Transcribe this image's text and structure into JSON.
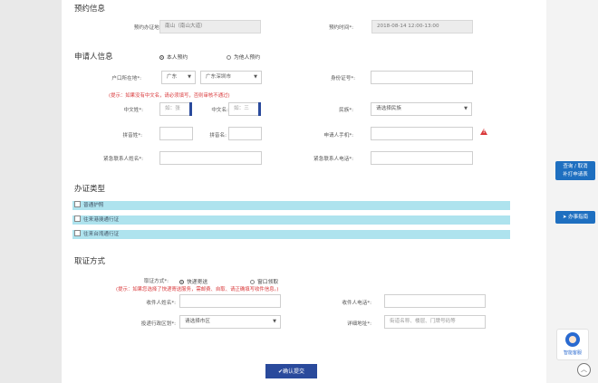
{
  "sections": {
    "booking": "预约信息",
    "applicant": "申请人信息",
    "type": "办证类型",
    "pickup": "取证方式"
  },
  "booking": {
    "location_label": "预约办证地点*:",
    "location_value": "南山（南山大道）",
    "time_label": "预约时间*:",
    "time_value": "2018-08-14 12:00-13:00"
  },
  "applicant": {
    "self_label": "本人预约",
    "other_label": "为他人预约",
    "hukou_label": "户口所在地*:",
    "province": "广东",
    "city": "广东深圳市",
    "id_label": "身份证号*:",
    "hint": "(提示：如果没有中文名，请必须填写，否则审核不通过)",
    "surname_label": "中文姓*:",
    "surname_ph": "如：张",
    "given_label": "中文名:",
    "given_ph": "如：三",
    "ethnic_label": "民族*:",
    "ethnic_value": "请选择民族",
    "pinyin_surname_label": "拼音姓*:",
    "pinyin_given_label": "拼音名:",
    "phone_label": "申请人手机*:",
    "warn_glyph": "!",
    "emer_name_label": "紧急联系人姓名*:",
    "emer_phone_label": "紧急联系人电话*:"
  },
  "types": [
    "普通护照",
    "往来港澳通行证",
    "往来台湾通行证"
  ],
  "pickup": {
    "method_label": "取证方式*:",
    "express_label": "快递寄送",
    "window_label": "窗口领取",
    "hint": "(提示：如果您选择了快递寄送服务，需邮费、自取、请正确填写收件信息。)",
    "recipient_label": "收件人姓名*:",
    "recipient_phone_label": "收件人电话*:",
    "district_label": "投递行政区划*:",
    "district_value": "请选择市区",
    "address_label": "详细地址*:",
    "address_ph": "街道名称、楼层、门牌号码等"
  },
  "submit": "✔确认提交",
  "sidebar": {
    "query_line1": "查询 / 取消",
    "query_line2": "补打申请表",
    "guide": "办事指南",
    "guide_icon": "send-icon",
    "service": "智能客服"
  }
}
